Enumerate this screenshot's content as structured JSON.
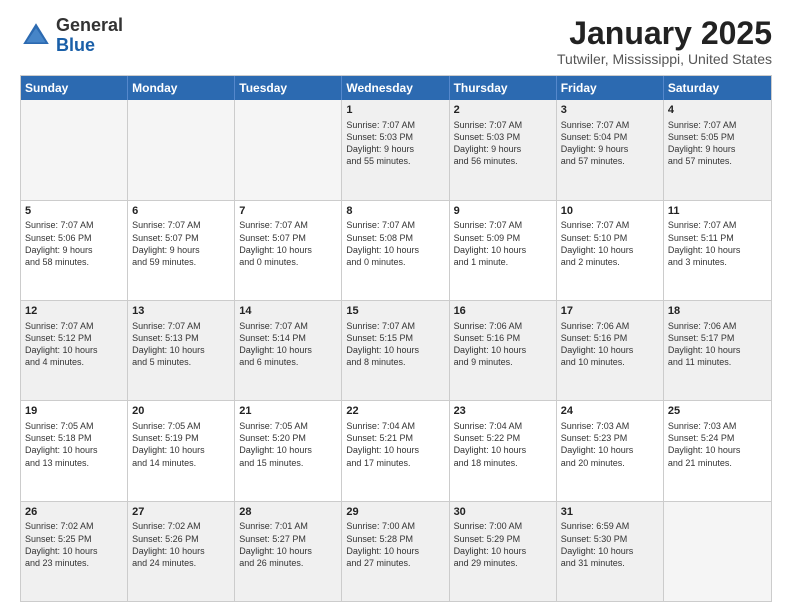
{
  "header": {
    "logo": {
      "general": "General",
      "blue": "Blue"
    },
    "title": "January 2025",
    "subtitle": "Tutwiler, Mississippi, United States"
  },
  "weekdays": [
    "Sunday",
    "Monday",
    "Tuesday",
    "Wednesday",
    "Thursday",
    "Friday",
    "Saturday"
  ],
  "rows": [
    [
      {
        "day": "",
        "info": "",
        "empty": true
      },
      {
        "day": "",
        "info": "",
        "empty": true
      },
      {
        "day": "",
        "info": "",
        "empty": true
      },
      {
        "day": "1",
        "info": "Sunrise: 7:07 AM\nSunset: 5:03 PM\nDaylight: 9 hours\nand 55 minutes."
      },
      {
        "day": "2",
        "info": "Sunrise: 7:07 AM\nSunset: 5:03 PM\nDaylight: 9 hours\nand 56 minutes."
      },
      {
        "day": "3",
        "info": "Sunrise: 7:07 AM\nSunset: 5:04 PM\nDaylight: 9 hours\nand 57 minutes."
      },
      {
        "day": "4",
        "info": "Sunrise: 7:07 AM\nSunset: 5:05 PM\nDaylight: 9 hours\nand 57 minutes."
      }
    ],
    [
      {
        "day": "5",
        "info": "Sunrise: 7:07 AM\nSunset: 5:06 PM\nDaylight: 9 hours\nand 58 minutes."
      },
      {
        "day": "6",
        "info": "Sunrise: 7:07 AM\nSunset: 5:07 PM\nDaylight: 9 hours\nand 59 minutes."
      },
      {
        "day": "7",
        "info": "Sunrise: 7:07 AM\nSunset: 5:07 PM\nDaylight: 10 hours\nand 0 minutes."
      },
      {
        "day": "8",
        "info": "Sunrise: 7:07 AM\nSunset: 5:08 PM\nDaylight: 10 hours\nand 0 minutes."
      },
      {
        "day": "9",
        "info": "Sunrise: 7:07 AM\nSunset: 5:09 PM\nDaylight: 10 hours\nand 1 minute."
      },
      {
        "day": "10",
        "info": "Sunrise: 7:07 AM\nSunset: 5:10 PM\nDaylight: 10 hours\nand 2 minutes."
      },
      {
        "day": "11",
        "info": "Sunrise: 7:07 AM\nSunset: 5:11 PM\nDaylight: 10 hours\nand 3 minutes."
      }
    ],
    [
      {
        "day": "12",
        "info": "Sunrise: 7:07 AM\nSunset: 5:12 PM\nDaylight: 10 hours\nand 4 minutes."
      },
      {
        "day": "13",
        "info": "Sunrise: 7:07 AM\nSunset: 5:13 PM\nDaylight: 10 hours\nand 5 minutes."
      },
      {
        "day": "14",
        "info": "Sunrise: 7:07 AM\nSunset: 5:14 PM\nDaylight: 10 hours\nand 6 minutes."
      },
      {
        "day": "15",
        "info": "Sunrise: 7:07 AM\nSunset: 5:15 PM\nDaylight: 10 hours\nand 8 minutes."
      },
      {
        "day": "16",
        "info": "Sunrise: 7:06 AM\nSunset: 5:16 PM\nDaylight: 10 hours\nand 9 minutes."
      },
      {
        "day": "17",
        "info": "Sunrise: 7:06 AM\nSunset: 5:16 PM\nDaylight: 10 hours\nand 10 minutes."
      },
      {
        "day": "18",
        "info": "Sunrise: 7:06 AM\nSunset: 5:17 PM\nDaylight: 10 hours\nand 11 minutes."
      }
    ],
    [
      {
        "day": "19",
        "info": "Sunrise: 7:05 AM\nSunset: 5:18 PM\nDaylight: 10 hours\nand 13 minutes."
      },
      {
        "day": "20",
        "info": "Sunrise: 7:05 AM\nSunset: 5:19 PM\nDaylight: 10 hours\nand 14 minutes."
      },
      {
        "day": "21",
        "info": "Sunrise: 7:05 AM\nSunset: 5:20 PM\nDaylight: 10 hours\nand 15 minutes."
      },
      {
        "day": "22",
        "info": "Sunrise: 7:04 AM\nSunset: 5:21 PM\nDaylight: 10 hours\nand 17 minutes."
      },
      {
        "day": "23",
        "info": "Sunrise: 7:04 AM\nSunset: 5:22 PM\nDaylight: 10 hours\nand 18 minutes."
      },
      {
        "day": "24",
        "info": "Sunrise: 7:03 AM\nSunset: 5:23 PM\nDaylight: 10 hours\nand 20 minutes."
      },
      {
        "day": "25",
        "info": "Sunrise: 7:03 AM\nSunset: 5:24 PM\nDaylight: 10 hours\nand 21 minutes."
      }
    ],
    [
      {
        "day": "26",
        "info": "Sunrise: 7:02 AM\nSunset: 5:25 PM\nDaylight: 10 hours\nand 23 minutes."
      },
      {
        "day": "27",
        "info": "Sunrise: 7:02 AM\nSunset: 5:26 PM\nDaylight: 10 hours\nand 24 minutes."
      },
      {
        "day": "28",
        "info": "Sunrise: 7:01 AM\nSunset: 5:27 PM\nDaylight: 10 hours\nand 26 minutes."
      },
      {
        "day": "29",
        "info": "Sunrise: 7:00 AM\nSunset: 5:28 PM\nDaylight: 10 hours\nand 27 minutes."
      },
      {
        "day": "30",
        "info": "Sunrise: 7:00 AM\nSunset: 5:29 PM\nDaylight: 10 hours\nand 29 minutes."
      },
      {
        "day": "31",
        "info": "Sunrise: 6:59 AM\nSunset: 5:30 PM\nDaylight: 10 hours\nand 31 minutes."
      },
      {
        "day": "",
        "info": "",
        "empty": true
      }
    ]
  ],
  "shaded_rows": [
    0,
    2,
    4
  ]
}
